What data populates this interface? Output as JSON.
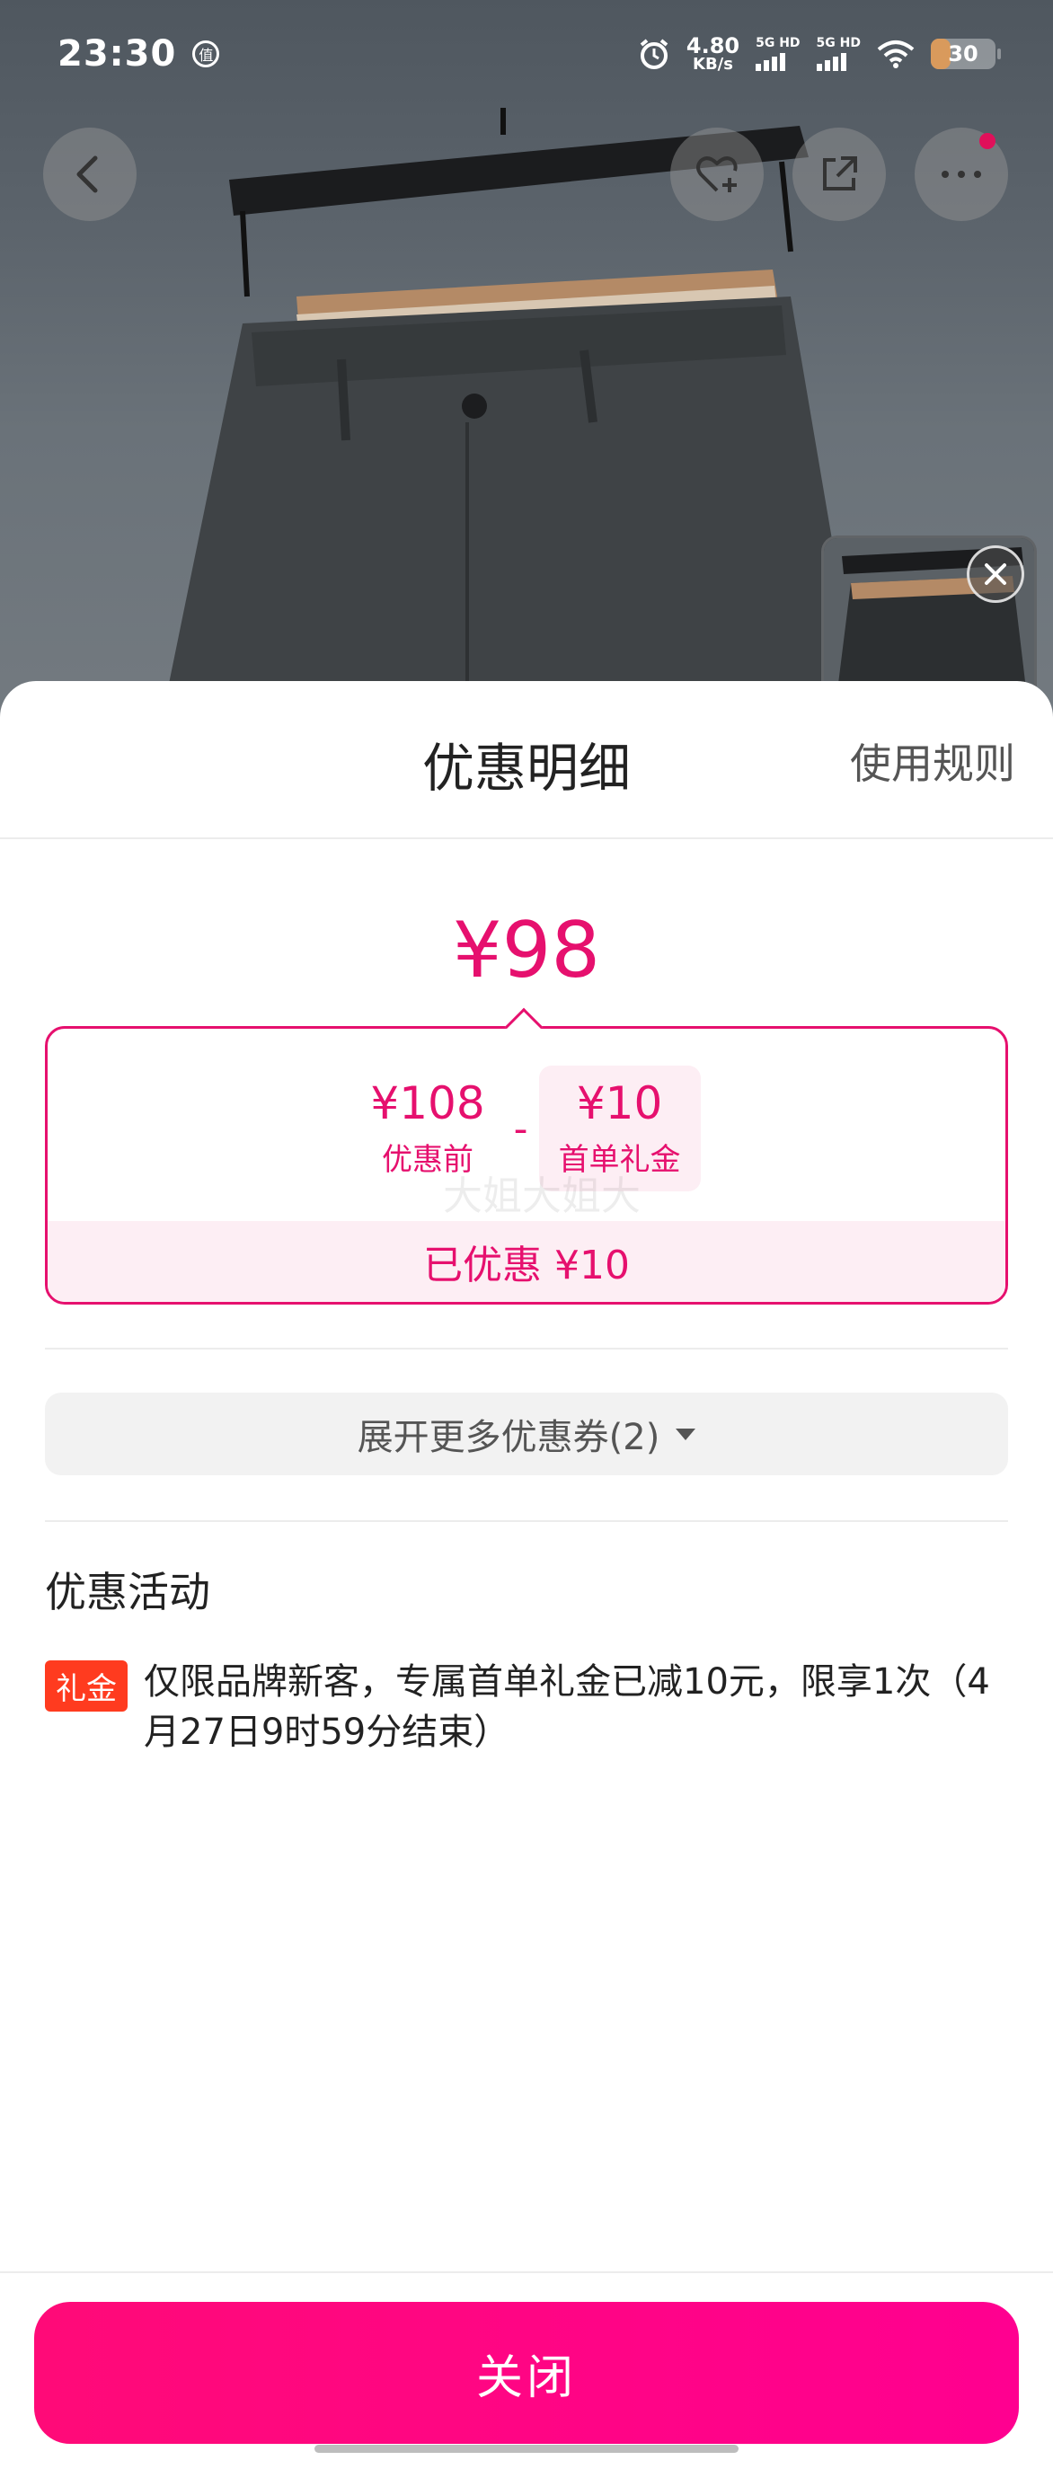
{
  "status_bar": {
    "time": "23:30",
    "badge": "值",
    "speed_value": "4.80",
    "speed_unit": "KB/s",
    "sim1_label": "5G HD",
    "sim2_label": "5G HD",
    "battery": "30"
  },
  "top_nav": {
    "back_icon": "chevron-left-icon",
    "favorite_icon": "heart-plus-icon",
    "share_icon": "share-icon",
    "more_icon": "more-dots-icon"
  },
  "sheet": {
    "title": "优惠明细",
    "rules_link": "使用规则",
    "final_price": "¥98",
    "breakdown": {
      "original_amount": "¥108",
      "original_label": "优惠前",
      "operator": "-",
      "coupon_amount": "¥10",
      "coupon_label": "首单礼金",
      "watermark": "大姐大姐大",
      "saved_text": "已优惠 ¥10"
    },
    "expand_label": "展开更多优惠券(2)",
    "activities_title": "优惠活动",
    "promo": {
      "tag": "礼金",
      "text": "仅限品牌新客，专属首单礼金已减10元，限享1次（4月27日9时59分结束）"
    },
    "close_label": "关闭"
  },
  "colors": {
    "accent": "#e6106e",
    "button_gradient_start": "#ff0a78",
    "tag_red": "#ff3b1f"
  }
}
